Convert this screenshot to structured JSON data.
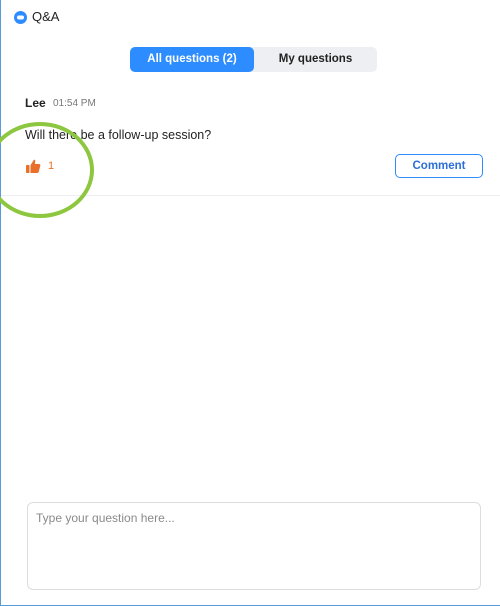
{
  "window": {
    "title": "Q&A"
  },
  "tabs": [
    {
      "label": "All questions (2)",
      "active": true
    },
    {
      "label": "My questions",
      "active": false
    }
  ],
  "question": {
    "author": "Lee",
    "time": "01:54 PM",
    "text": "Will there be a follow-up session?",
    "like_count": "1",
    "comment_label": "Comment"
  },
  "compose": {
    "placeholder": "Type your question here..."
  },
  "colors": {
    "accent": "#2d8cff",
    "like": "#e8702a",
    "highlight": "#8dc63f"
  },
  "icons": {
    "app": "qa-app-icon",
    "like": "thumbs-up-icon"
  }
}
